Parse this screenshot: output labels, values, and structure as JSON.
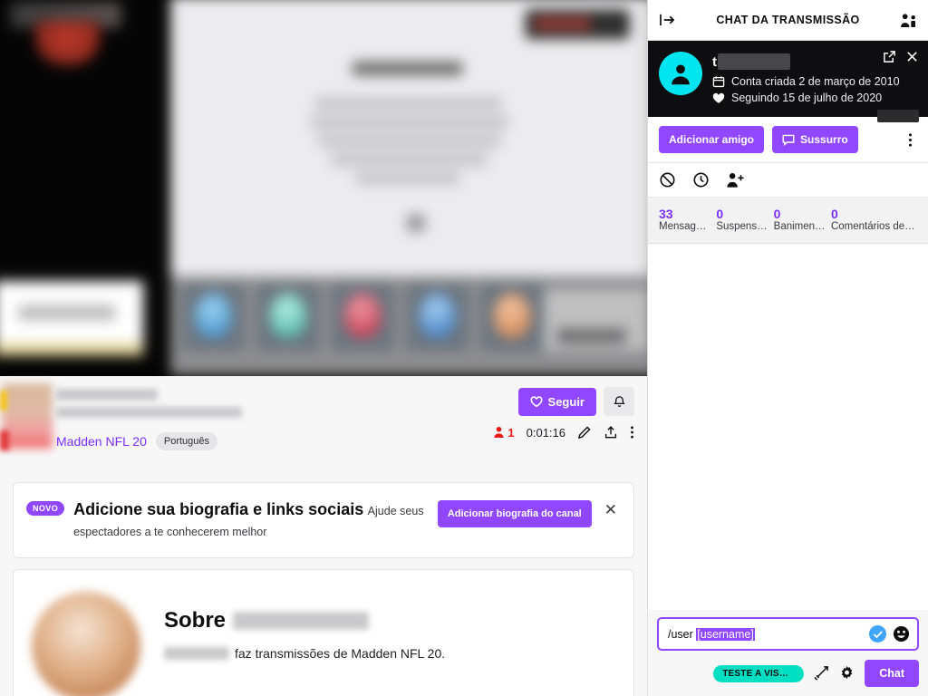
{
  "player": {
    "tiles": [
      {
        "name": "tile-blue-1",
        "color": "#4a9fd8"
      },
      {
        "name": "tile-teal",
        "color": "#58c9bb"
      },
      {
        "name": "tile-red",
        "color": "#d1465a"
      },
      {
        "name": "tile-blue-2",
        "color": "#3f8dd4"
      },
      {
        "name": "tile-orange",
        "color": "#dd8a5c"
      }
    ]
  },
  "stream_info": {
    "category": "Madden NFL 20",
    "language_tag": "Português",
    "follow_label": "Seguir",
    "viewers": "1",
    "uptime": "0:01:16",
    "icons": {
      "heart": "heart-icon",
      "bell": "bell-icon",
      "viewers": "viewer-count-icon",
      "edit": "pencil-icon",
      "share": "share-icon",
      "more": "kebab-menu-icon"
    }
  },
  "banner": {
    "badge": "NOVO",
    "title": "Adicione sua biografia e links sociais",
    "subtitle": "Ajude seus espectadores a te conhecerem melhor",
    "cta_label": "Adicionar biografia do canal",
    "close_label": "✕"
  },
  "about": {
    "heading": "Sobre",
    "description_suffix": "faz transmissões de Madden NFL 20."
  },
  "chat": {
    "header": {
      "title": "CHAT DA TRANSMISSÃO",
      "collapse_icon": "collapse-chat-icon",
      "community_icon": "community-users-icon"
    },
    "viewer_card": {
      "account_created": "Conta criada 2 de março de 2010",
      "following_since": "Seguindo 15 de julho de 2020",
      "popout_icon": "popout-icon",
      "close_icon": "close-icon",
      "calendar_icon": "calendar-icon",
      "heart_icon": "heart-filled-icon",
      "avatar_icon": "default-avatar-icon"
    },
    "actions": {
      "add_friend": "Adicionar amigo",
      "whisper": "Sussurro",
      "more_icon": "kebab-menu-icon"
    },
    "mod_icons": [
      {
        "name": "ban-icon"
      },
      {
        "name": "timeout-clock-icon"
      },
      {
        "name": "add-moderator-icon"
      }
    ],
    "stats": [
      {
        "value": "33",
        "label": "Mensag…"
      },
      {
        "value": "0",
        "label": "Suspens…"
      },
      {
        "value": "0",
        "label": "Banimen…"
      },
      {
        "value": "0",
        "label": "Comentários de …"
      }
    ],
    "input": {
      "command": "/user ",
      "selected_text": "[username]",
      "verify_icon": "check-circle-icon",
      "emote_icon": "smiley-emote-icon"
    },
    "bottom": {
      "test_badge": "TESTE A VISUA...",
      "sword_icon": "sword-mod-icon",
      "gear_icon": "gear-settings-icon",
      "send_label": "Chat"
    }
  },
  "colors": {
    "purple": "#9147ff",
    "purple_link": "#7b2ff7",
    "teal": "#00dfc2",
    "live_red": "#e91916",
    "avatar_cyan": "#00e5ef"
  }
}
